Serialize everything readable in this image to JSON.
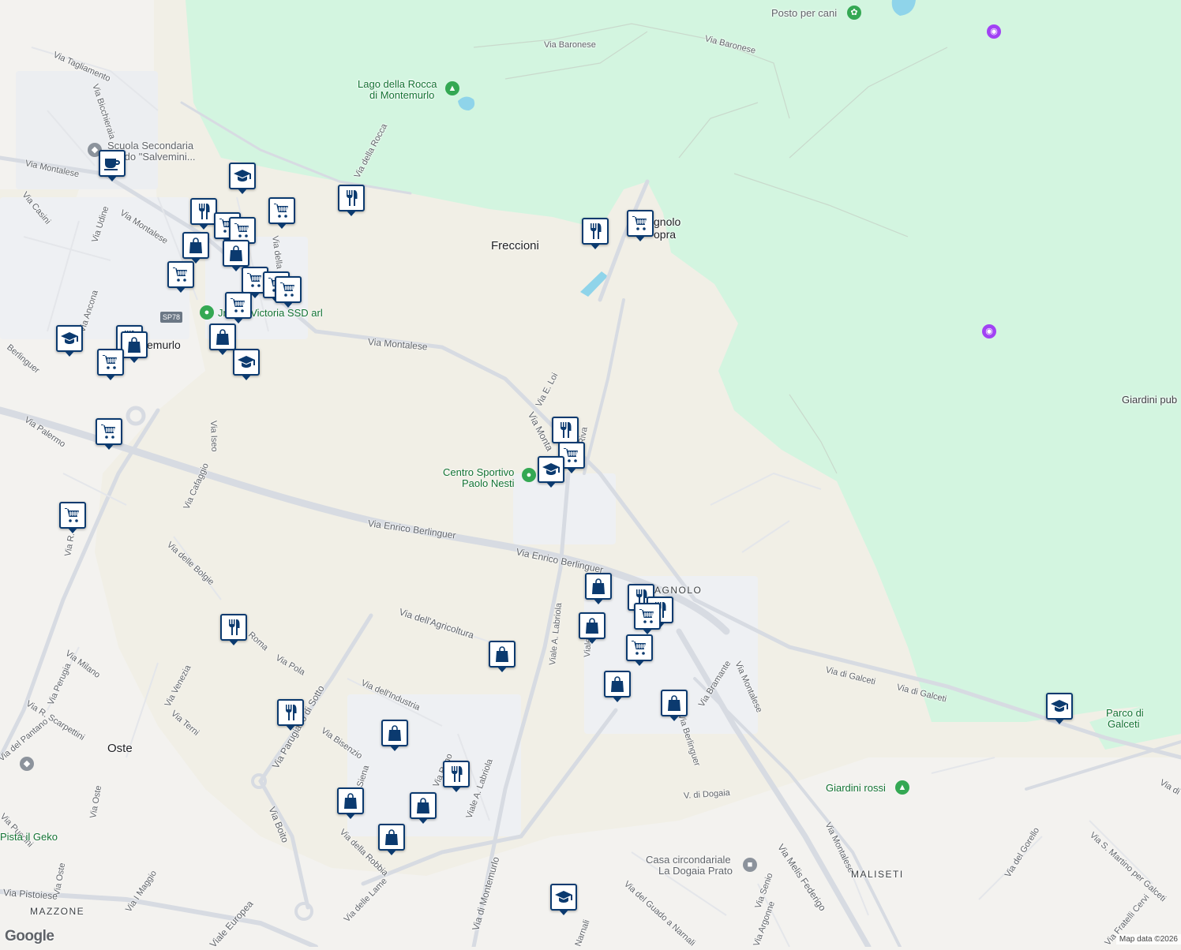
{
  "map": {
    "attribution": "Map data ©2026",
    "logo": "Google",
    "colors": {
      "park": "#d3f5e0",
      "land": "#f3f2ef",
      "tan": "#f1efe6",
      "road": "#dfe2e8",
      "water": "#8fd4ea",
      "pin_border": "#0b3a6f",
      "green_poi": "#34a853",
      "purple_poi": "#a142f4"
    }
  },
  "labels": {
    "posto_cani": "Posto per cani",
    "via_baronese_1": "Via Baronese",
    "via_baronese_2": "Via Baronese",
    "lago_1": "Lago della Rocca",
    "lago_2": "di Montemurlo",
    "via_tagliamento": "Via Tagliamento",
    "via_bicchieraia": "Via Bicchieraia",
    "scuola_1": "Scuola Secondaria",
    "scuola_2": "Grado \"Salvemini...",
    "via_della_rocca": "Via della Rocca",
    "via_montalese_1": "Via Montalese",
    "via_casini": "Via Casini",
    "via_udine": "Via Udine",
    "via_montalese_2": "Via Montalese",
    "via_della_ro": "Via della Ro",
    "freccioni": "Freccioni",
    "bagnolo_sopra_1": "gnolo",
    "bagnolo_sopra_2": "opra",
    "sp78": "SP78",
    "victoria": "Jnioso Victoria SSD arl",
    "via_ancona": "Via Ancona",
    "montemurlo": "emurlo",
    "via_montalese_3": "Via Montalese",
    "berlinguer_1": "Berlinguer",
    "via_e_loi": "Via E. Loi",
    "via_montalese_4": "Via Monta",
    "riva": "Riva",
    "via_iseo": "Via Iseo",
    "via_palermo": "Via Palermo",
    "centro_1": "Centro Sportivo",
    "centro_2": "Paolo Nesti",
    "via_cafaggio": "Via Cafaggio",
    "via_pettini": "Via R. Pettini",
    "berlinguer_2": "Via Enrico Berlinguer",
    "berlinguer_3": "Via Enrico Berlinguer",
    "giardini_pub": "Giardini pub",
    "via_delle_bolgie": "Via delle Bolgie",
    "bagnolo": "AGNOLO",
    "labriola_1": "Viale A. Labriola",
    "via_agricoltura": "Via dell'Agricoltura",
    "via_roma": "Roma",
    "via_pola": "Via Pola",
    "via_milano": "Via Milano",
    "via_perugia": "Via Perugia",
    "via_venezia": "Via Venezia",
    "via_bramante": "Via Bramante",
    "via_montalese_5": "Via Montalese",
    "via_di_galceti_1": "Via di Galceti",
    "via_di_galceti_2": "Via di Galceti",
    "parco_1": "Parco di",
    "parco_2": "Galceti",
    "scarpettini": "Via R. Scarpettini",
    "via_del_pantano": "Via del Pantano",
    "via_terni": "Via Terni",
    "via_industria": "Via dell'Industria",
    "parugiano": "Via Parugiano di Sotto",
    "oste": "Oste",
    "via_bisenzio": "Via Bisenzio",
    "berlinguer_4": "Via Berlinguer",
    "via_reno": "Via Reno",
    "labriola_2": "Viale A. Labriola",
    "via_siena": "Via Siena",
    "giardini_rossi": "Giardini rossi",
    "v_dogaia": "V. di Dogaia",
    "via_puccini": "Via Puccini",
    "pista": "Pista il Geko",
    "via_oste": "Via Oste",
    "via_boito": "Via Boito",
    "via_della_robbia": "Via della Robbia",
    "casa_1": "Casa circondariale",
    "casa_2": "La Dogaia Prato",
    "via_montalese_6": "Via Montalese",
    "maliseti": "MALISETI",
    "via_del_gorello": "Via del Gorello",
    "via_s_martino": "Via S. Martino per Galceti",
    "via_oste_2": "Via Oste",
    "via_i_maggio": "Via I Maggio",
    "via_pistoiese": "Via Pistoiese",
    "mazzone": "MAZZONE",
    "via_delle_lame": "Via delle Lame",
    "via_di_montemurlo": "Via di Montemurlo",
    "via_del_guado": "Via del Guado a Narnali",
    "via_senio": "Via Senio",
    "via_argonne": "Via Argonne",
    "via_melis": "Via Melis Federigo",
    "europea": "Viale Europea",
    "narnali": "Narnali",
    "fratelli_cervi": "Via Fratelli Cervi",
    "via_di": "Via di",
    "viale_short": "Viale",
    "via_montalese_7": "Via Montalese"
  },
  "pins": [
    {
      "type": "cafe",
      "icon": "coffee-cup-icon"
    },
    {
      "type": "school",
      "icon": "graduation-cap-icon"
    },
    {
      "type": "restaurant",
      "icon": "fork-knife-icon"
    },
    {
      "type": "restaurant",
      "icon": "fork-knife-icon"
    },
    {
      "type": "shopping",
      "icon": "shopping-cart-icon"
    },
    {
      "type": "shopping",
      "icon": "shopping-cart-icon"
    },
    {
      "type": "shopping",
      "icon": "shopping-cart-icon"
    },
    {
      "type": "store",
      "icon": "shopping-bag-icon"
    },
    {
      "type": "store",
      "icon": "shopping-bag-icon"
    },
    {
      "type": "shopping",
      "icon": "shopping-cart-icon"
    },
    {
      "type": "shopping",
      "icon": "shopping-cart-icon"
    },
    {
      "type": "shopping",
      "icon": "shopping-cart-icon"
    },
    {
      "type": "shopping",
      "icon": "shopping-cart-icon"
    },
    {
      "type": "shopping",
      "icon": "shopping-cart-icon"
    },
    {
      "type": "store",
      "icon": "shopping-bag-icon"
    },
    {
      "type": "school",
      "icon": "graduation-cap-icon"
    },
    {
      "type": "school",
      "icon": "graduation-cap-icon"
    },
    {
      "type": "restaurant",
      "icon": "fork-knife-icon"
    },
    {
      "type": "store",
      "icon": "shopping-bag-icon"
    },
    {
      "type": "shopping",
      "icon": "shopping-cart-icon"
    },
    {
      "type": "shopping",
      "icon": "shopping-cart-icon"
    },
    {
      "type": "shopping",
      "icon": "shopping-cart-icon"
    },
    {
      "type": "restaurant",
      "icon": "fork-knife-icon"
    },
    {
      "type": "shopping",
      "icon": "shopping-cart-icon"
    },
    {
      "type": "restaurant",
      "icon": "fork-knife-icon"
    },
    {
      "type": "shopping",
      "icon": "shopping-cart-icon"
    },
    {
      "type": "school",
      "icon": "graduation-cap-icon"
    },
    {
      "type": "store",
      "icon": "shopping-bag-icon"
    },
    {
      "type": "restaurant",
      "icon": "fork-knife-icon"
    },
    {
      "type": "restaurant",
      "icon": "fork-knife-icon"
    },
    {
      "type": "shopping",
      "icon": "shopping-cart-icon"
    },
    {
      "type": "store",
      "icon": "shopping-bag-icon"
    },
    {
      "type": "restaurant",
      "icon": "fork-knife-icon"
    },
    {
      "type": "shopping",
      "icon": "shopping-cart-icon"
    },
    {
      "type": "store",
      "icon": "shopping-bag-icon"
    },
    {
      "type": "store",
      "icon": "shopping-bag-icon"
    },
    {
      "type": "store",
      "icon": "shopping-bag-icon"
    },
    {
      "type": "restaurant",
      "icon": "fork-knife-icon"
    },
    {
      "type": "store",
      "icon": "shopping-bag-icon"
    },
    {
      "type": "restaurant",
      "icon": "fork-knife-icon"
    },
    {
      "type": "store",
      "icon": "shopping-bag-icon"
    },
    {
      "type": "store",
      "icon": "shopping-bag-icon"
    },
    {
      "type": "store",
      "icon": "shopping-bag-icon"
    },
    {
      "type": "school",
      "icon": "graduation-cap-icon"
    },
    {
      "type": "school",
      "icon": "graduation-cap-icon"
    }
  ]
}
